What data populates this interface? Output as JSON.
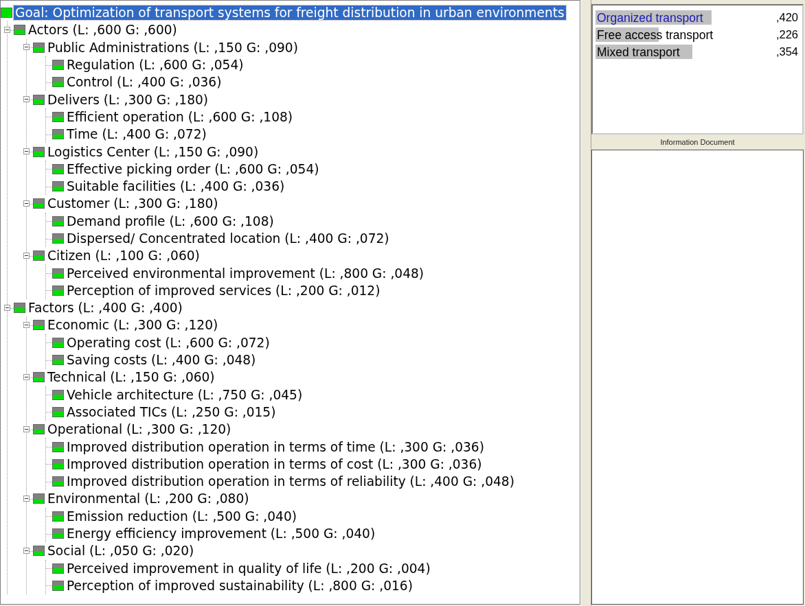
{
  "tree": {
    "label": "Goal: Optimization of transport systems for freight distribution in urban environments",
    "selected": true,
    "children": [
      {
        "label": "Actors (L: ,600 G: ,600)",
        "selected": false,
        "expanded": true,
        "children": [
          {
            "label": "Public Administrations (L: ,150 G: ,090)",
            "selected": false,
            "expanded": true,
            "children": [
              {
                "label": "Regulation (L: ,600 G: ,054)",
                "selected": false
              },
              {
                "label": "Control (L: ,400 G: ,036)",
                "selected": false
              }
            ]
          },
          {
            "label": "Delivers (L: ,300 G: ,180)",
            "selected": false,
            "expanded": true,
            "children": [
              {
                "label": "Efficient operation (L: ,600 G: ,108)",
                "selected": false
              },
              {
                "label": "Time (L: ,400 G: ,072)",
                "selected": false
              }
            ]
          },
          {
            "label": "Logistics Center (L: ,150 G: ,090)",
            "selected": false,
            "expanded": true,
            "children": [
              {
                "label": "Effective picking order (L: ,600 G: ,054)",
                "selected": false
              },
              {
                "label": "Suitable facilities (L: ,400 G: ,036)",
                "selected": false
              }
            ]
          },
          {
            "label": "Customer (L: ,300 G: ,180)",
            "selected": false,
            "expanded": true,
            "children": [
              {
                "label": "Demand profile (L: ,600 G: ,108)",
                "selected": false
              },
              {
                "label": "Dispersed/ Concentrated location (L: ,400 G: ,072)",
                "selected": false
              }
            ]
          },
          {
            "label": "Citizen (L: ,100 G: ,060)",
            "selected": false,
            "expanded": true,
            "children": [
              {
                "label": "Perceived environmental improvement (L: ,800 G: ,048)",
                "selected": false
              },
              {
                "label": "Perception of improved services (L: ,200 G: ,012)",
                "selected": false
              }
            ]
          }
        ]
      },
      {
        "label": "Factors (L: ,400 G: ,400)",
        "selected": false,
        "expanded": true,
        "children": [
          {
            "label": "Economic (L: ,300 G: ,120)",
            "selected": false,
            "expanded": true,
            "children": [
              {
                "label": "Operating cost (L: ,600 G: ,072)",
                "selected": false
              },
              {
                "label": "Saving costs (L: ,400 G: ,048)",
                "selected": false
              }
            ]
          },
          {
            "label": "Technical (L: ,150 G: ,060)",
            "selected": false,
            "expanded": true,
            "children": [
              {
                "label": "Vehicle architecture (L: ,750 G: ,045)",
                "selected": false
              },
              {
                "label": "Associated TICs (L: ,250 G: ,015)",
                "selected": false
              }
            ]
          },
          {
            "label": "Operational (L: ,300 G: ,120)",
            "selected": false,
            "expanded": true,
            "children": [
              {
                "label": "Improved distribution operation in terms of time (L: ,300 G: ,036)",
                "selected": false
              },
              {
                "label": "Improved distribution operation in terms of cost (L: ,300 G: ,036)",
                "selected": false
              },
              {
                "label": "Improved distribution operation in terms of reliability (L: ,400 G: ,048)",
                "selected": false
              }
            ]
          },
          {
            "label": "Environmental (L: ,200 G: ,080)",
            "selected": false,
            "expanded": true,
            "children": [
              {
                "label": "Emission reduction (L: ,500 G: ,040)",
                "selected": false
              },
              {
                "label": "Energy efficiency improvement (L: ,500 G: ,040)",
                "selected": false
              }
            ]
          },
          {
            "label": "Social (L: ,050 G: ,020)",
            "selected": false,
            "expanded": true,
            "children": [
              {
                "label": "Perceived improvement in quality of life (L: ,200 G: ,004)",
                "selected": false
              },
              {
                "label": "Perception of improved sustainability (L: ,800 G: ,016)",
                "selected": false
              }
            ]
          }
        ]
      }
    ]
  },
  "alternatives": [
    {
      "name": "Organized transport",
      "value": ",420",
      "level": 0.96,
      "selected": true
    },
    {
      "name": "Free access transport",
      "value": ",226",
      "level": 0.52,
      "selected": false
    },
    {
      "name": "Mixed transport",
      "value": ",354",
      "level": 0.8,
      "selected": false
    }
  ],
  "info_panel": {
    "title": "Information Document"
  }
}
